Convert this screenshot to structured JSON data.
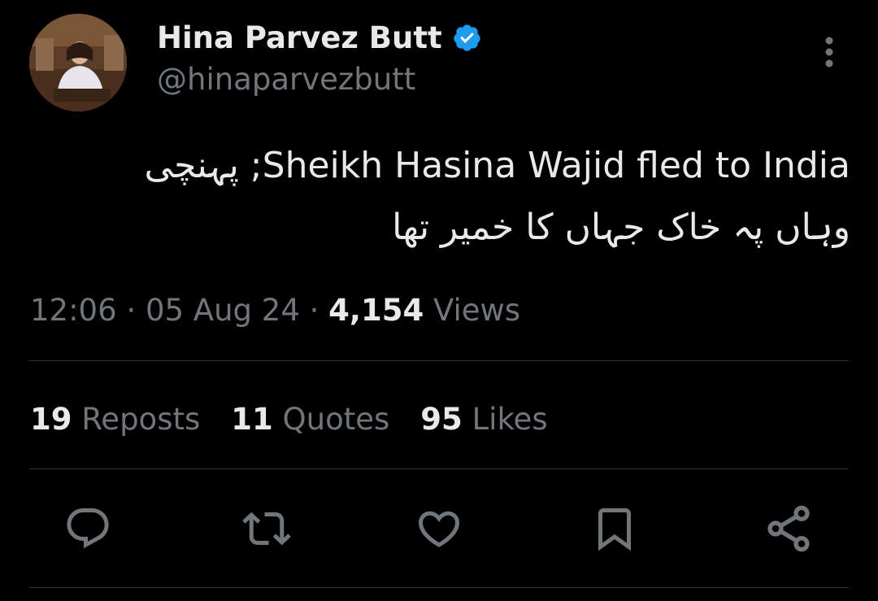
{
  "author": {
    "display_name": "Hina Parvez Butt",
    "handle": "@hinaparvezbutt",
    "verified": true,
    "avatar_icon": "profile-photo"
  },
  "tweet": {
    "text": "Sheikh Hasina Wajid fled to India; پہنچی\nوہاں پہ خاک جہاں کا خمیر تھا"
  },
  "meta": {
    "time": "12:06",
    "separator": " · ",
    "date": "05 Aug 24",
    "views_count": "4,154",
    "views_label": " Views"
  },
  "stats": {
    "reposts_count": "19",
    "reposts_label": " Reposts",
    "quotes_count": "11",
    "quotes_label": " Quotes",
    "likes_count": "95",
    "likes_label": " Likes"
  },
  "actions": [
    {
      "icon": "reply-icon"
    },
    {
      "icon": "repost-icon"
    },
    {
      "icon": "like-icon"
    },
    {
      "icon": "bookmark-icon"
    },
    {
      "icon": "share-icon"
    }
  ],
  "colors": {
    "background": "#000000",
    "primary_text": "#e7e9ea",
    "secondary_text": "#71767b",
    "divider": "#2f3336",
    "verified_badge": "#1d9bf0"
  }
}
